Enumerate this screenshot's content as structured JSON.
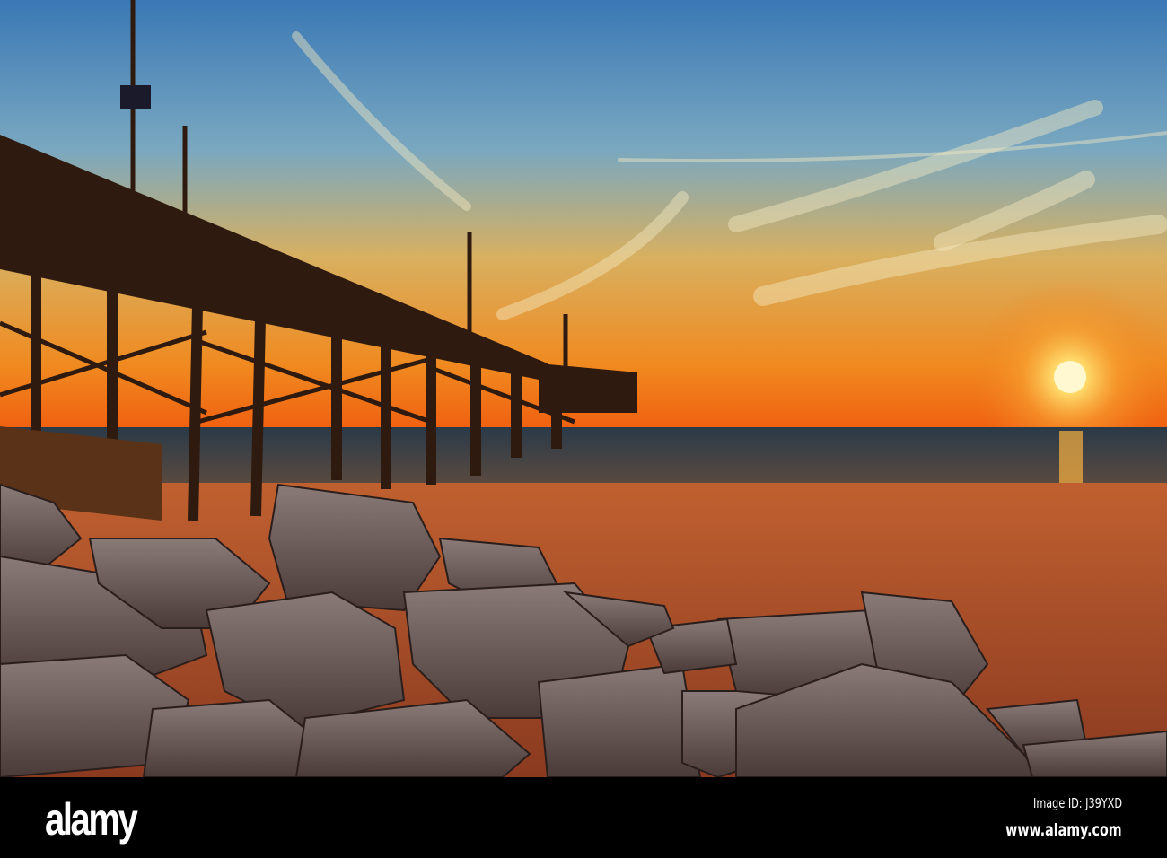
{
  "photo": {
    "subject": "Pier at sunset over the ocean with rocks on the beach",
    "colors": {
      "sky_top": "#3f7fb8",
      "sky_mid": "#9fb5a8",
      "sky_low": "#f0a030",
      "horizon": "#f06a10",
      "sun": "#fff6c0",
      "sand": "#b0502a",
      "pier": "#3a2010"
    }
  },
  "watermark": {
    "logo_text": "alamy",
    "image_id_label": "Image ID: J39YXD",
    "website": "www.alamy.com"
  }
}
